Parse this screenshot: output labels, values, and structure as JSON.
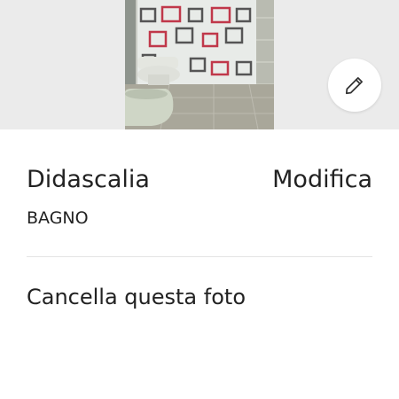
{
  "caption": {
    "title": "Didascalia",
    "edit_label": "Modifica",
    "value": "BAGNO"
  },
  "actions": {
    "delete_label": "Cancella questa foto"
  },
  "icons": {
    "edit": "pencil-icon"
  },
  "colors": {
    "photo_background": "#ebebeb",
    "text": "#222222",
    "divider": "#e4e4e4"
  }
}
